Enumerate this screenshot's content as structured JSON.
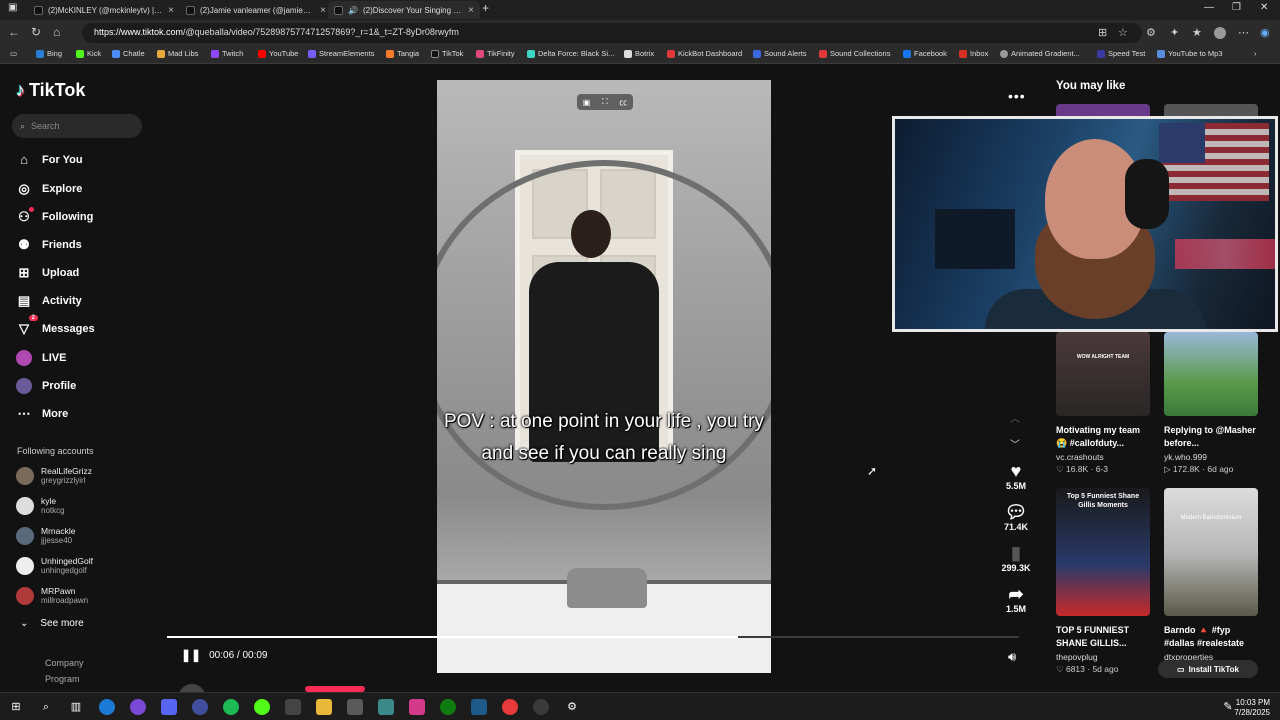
{
  "browser": {
    "tabs": [
      {
        "title": "(2)McKINLEY (@mckinleytv) | TikT",
        "active": false
      },
      {
        "title": "(2)Jamie vanleamer (@jamie_vani",
        "active": false
      },
      {
        "title": "(2)Discover Your Singing Pot",
        "active": true
      }
    ],
    "url_host": "https://www.tiktok.com",
    "url_path": "/@queballa/video/7528987577471257869?_r=1&_t=ZT-8yDr08rwyfm",
    "bookmarks": [
      "Bing",
      "Kick",
      "Chatle",
      "Mad Libs",
      "Twitch",
      "YouTube",
      "StreamElements",
      "Tangia",
      "TikTok",
      "TikFinity",
      "Delta Force: Black Si...",
      "Botrix",
      "KickBot Dashboard",
      "Sound Alerts",
      "Sound Collections",
      "Facebook",
      "Inbox",
      "Animated Gradient...",
      "Speed Test",
      "YouTube to Mp3"
    ]
  },
  "tiktok": {
    "logo": "TikTok",
    "search_placeholder": "Search",
    "nav": [
      {
        "label": "For You",
        "icon": "home-icon"
      },
      {
        "label": "Explore",
        "icon": "compass-icon"
      },
      {
        "label": "Following",
        "icon": "following-icon"
      },
      {
        "label": "Friends",
        "icon": "friends-icon"
      },
      {
        "label": "Upload",
        "icon": "upload-icon"
      },
      {
        "label": "Activity",
        "icon": "activity-icon"
      },
      {
        "label": "Messages",
        "icon": "messages-icon",
        "badge": "2"
      },
      {
        "label": "LIVE",
        "icon": "live-icon"
      },
      {
        "label": "Profile",
        "icon": "profile-icon"
      },
      {
        "label": "More",
        "icon": "more-icon"
      }
    ],
    "following_title": "Following accounts",
    "accounts": [
      {
        "name": "RealLifeGrizz",
        "user": "greygrizzlyirl"
      },
      {
        "name": "kyle",
        "user": "notkcg"
      },
      {
        "name": "Mrnackle",
        "user": "jjjesse40"
      },
      {
        "name": "UnhingedGolf",
        "user": "unhingedgolf"
      },
      {
        "name": "MRPawn",
        "user": "millroadpawn"
      }
    ],
    "see_more": "See more",
    "footer": [
      "Company",
      "Program"
    ],
    "video": {
      "caption": "POV : at one point in your life , you  try and see if you can really sing",
      "time": "00:06 / 00:09",
      "progress": 0.67,
      "creator": "queballa"
    },
    "actions": [
      {
        "icon": "heart-icon",
        "count": "5.5M"
      },
      {
        "icon": "comment-icon",
        "count": "71.4K"
      },
      {
        "icon": "bookmark-icon",
        "count": "299.3K"
      },
      {
        "icon": "share-icon",
        "count": "1.5M"
      }
    ],
    "you_may_like": "You may like",
    "suggestions": [
      {
        "title": "Motivating my team 😭 #callofduty...",
        "user": "vc.crashouts",
        "stats": "♡ 16.8K · 6-3",
        "thumb_text": "WOW ALRIGHT TEAM"
      },
      {
        "title": "Replying to @Masher before...",
        "user": "yk.who.999",
        "stats": "▷ 172.8K · 6d ago",
        "thumb_text": ""
      },
      {
        "title": "TOP 5 FUNNIEST SHANE GILLIS...",
        "user": "thepovplug",
        "stats": "♡ 6813 · 5d ago",
        "thumb_text": "Top 5 Funniest Shane Gillis Moments"
      },
      {
        "title": "Barndo 🔺 #fyp #dallas #realestate",
        "user": "dtxproperties",
        "stats": "",
        "thumb_text": "Modern Barndominium"
      }
    ],
    "install": "Install TikTok"
  },
  "taskbar": {
    "time": "10:03 PM",
    "date": "7/28/2025"
  }
}
